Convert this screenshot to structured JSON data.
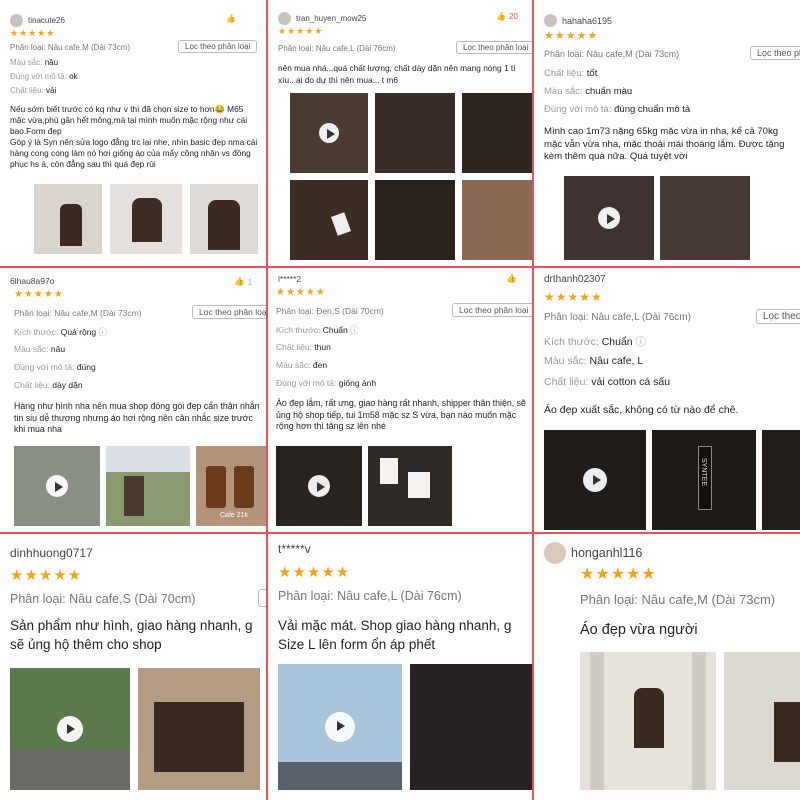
{
  "filter_label": "Lọc theo phân loại",
  "stars": "★★★★★",
  "labels": {
    "variant": "Phân loại:",
    "color": "Màu sắc:",
    "size": "Kích thước:",
    "material": "Chất liệu:",
    "match": "Đúng với mô tả:"
  },
  "reviews": [
    {
      "user": "tinacute26",
      "variant": "Nâu cafe,M (Dài 73cm)",
      "color": "nâu",
      "match": "ok",
      "material": "vải",
      "text": "Nếu sớm biết trước có kq như v thì đã chọn size to hơn😂 M65 mặc vừa,phù gần hết mông,mà tại mình muốn mặc rộng như cái bao.Form đẹp\nGóp ý là Syn nên sửa logo đẳng trc lại nhe, nhìn basic đẹp nma cái hàng cong cong làm nó hơi giống áo của mấy công nhân vs đồng phục hs á, còn đẳng sau thì quá đẹp rùi"
    },
    {
      "user": "tran_huyen_mow25",
      "likes": "20",
      "variant": "Nâu cafe,L (Dài 76cm)",
      "text": "nên mua nhá...quá chất lượng, chất dày dặn nên mang nóng 1 tí xíu.. ai do dự thì nên mua... t m6"
    },
    {
      "user": "hahaha6195",
      "variant": "Nâu cafe,M (Dài 73cm)",
      "material": "tốt",
      "color": "chuẩn màu",
      "match": "đúng chuẩn mô tả",
      "text": "Mình cao 1m73 nặng 65kg mặc vừa in nha, kể cả 70kg mặc vẫn vừa nha, mặc thoải mái thoáng lắm. Được tặng kèm thêm quà nữa. Quá tuyệt vời"
    },
    {
      "user": "6lhau8a97o",
      "likes": "1",
      "variant": "Nâu cafe,M (Dài 73cm)",
      "size": "Quá rộng",
      "color": "nâu",
      "match": "đúng",
      "material": "dày dặn",
      "text": "Hàng như hình nha nên mua shop đóng gói đẹp cẩn thận nhắn tin siu dễ thương nhưng áo hơi rộng nên cân nhắc size trước khi mua nha",
      "photo_caption": "Cafe 21k"
    },
    {
      "user": "l*****2",
      "variant": "Đen,S (Dài 70cm)",
      "size": "Chuẩn",
      "material": "thun",
      "color": "đen",
      "match": "giống ảnh",
      "text": "Áo đẹp lắm, rất ưng, giao hàng rất nhanh, shipper thân thiện, sẽ ủng hộ shop tiếp, tui 1m58 mặc sz S vừa, bạn nào muốn mặc rộng hơn thì tăng sz lên nhé"
    },
    {
      "user": "drthanh02307",
      "variant": "Nâu cafe,L (Dài 76cm)",
      "size": "Chuẩn",
      "color": "Nâu cafe, L",
      "material": "vải cotton cá sấu",
      "text": "Áo đẹp xuất sắc, không có từ nào để chê.",
      "photo_caption": "SYNTEE"
    },
    {
      "user": "dinhhuong0717",
      "variant": "Nâu cafe,S (Dài 70cm)",
      "text": "Sản phẩm như hình, giao hàng nhanh, g sẽ ủng hộ thêm cho shop"
    },
    {
      "user": "t*****v",
      "variant": "Nâu cafe,L (Dài 76cm)",
      "text": "Vải mặc mát. Shop giao hàng nhanh, g Size L lên form ổn áp phết"
    },
    {
      "user": "honganhl116",
      "variant": "Nâu cafe,M (Dài 73cm)",
      "text": "Áo đẹp vừa người"
    }
  ]
}
